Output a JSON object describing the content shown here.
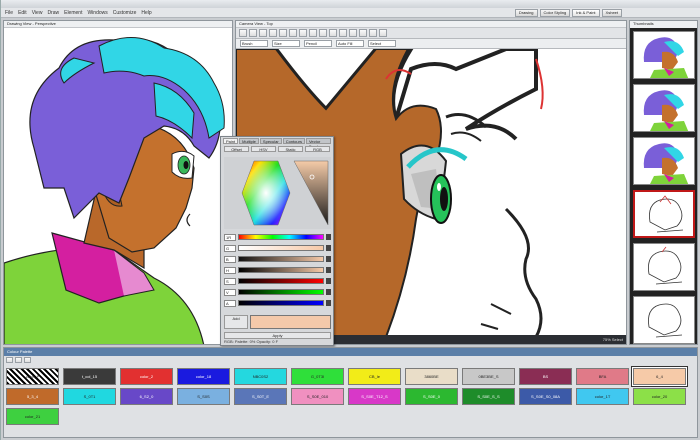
{
  "menu": {
    "items": [
      "File",
      "Edit",
      "View",
      "Draw",
      "Element",
      "Windows",
      "Customize",
      "Help"
    ]
  },
  "workspace_buttons": [
    "Drawing",
    "Color Styling",
    "Ink & Paint",
    "Xsheet"
  ],
  "left_panel": {
    "title": "Drawing View - Perspective"
  },
  "main_view": {
    "title": "Camera View - Top",
    "props": [
      "Brush",
      "Size",
      "Pencil",
      "Auto Fill",
      "Select"
    ],
    "status_right": "75% Select"
  },
  "thumbnails": {
    "title": "Thumbnails"
  },
  "color_picker": {
    "tabs": [
      "Paint",
      "Multiple",
      "Specular",
      "Contours",
      "Vector Brush"
    ],
    "modes": [
      "Offset",
      "HSV",
      "Static",
      "RGB"
    ],
    "sliders": [
      {
        "label": "1R",
        "value": "255"
      },
      {
        "label": "G",
        "value": "218"
      },
      {
        "label": "B",
        "value": "198"
      },
      {
        "label": "H",
        "value": "24"
      },
      {
        "label": "S",
        "value": "22"
      },
      {
        "label": "V",
        "value": "100"
      },
      {
        "label": "A",
        "value": "100"
      }
    ],
    "btn_add": "Add",
    "btn_apply": "Apply",
    "status": "RGB: Palette: 0% Opacity: 0 F"
  },
  "palette": {
    "title": "Colour Palette",
    "swatches": [
      {
        "name": "color_P",
        "color": "#f4f4f4",
        "row": 0,
        "col": 0,
        "text": "light",
        "pattern": true
      },
      {
        "name": "t_col_15",
        "color": "#3a3a3a",
        "row": 0,
        "col": 1,
        "text": "dark"
      },
      {
        "name": "color_2",
        "color": "#e23030",
        "row": 0,
        "col": 2,
        "text": "dark"
      },
      {
        "name": "color_18",
        "color": "#1a1adf",
        "row": 0,
        "col": 3,
        "text": "dark"
      },
      {
        "name": "NBC0S2",
        "color": "#24d8df",
        "row": 0,
        "col": 4,
        "text": "light"
      },
      {
        "name": "G_0T3I",
        "color": "#2fdf3a",
        "row": 0,
        "col": 5,
        "text": "light"
      },
      {
        "name": "CB_le",
        "color": "#f2ec18",
        "row": 0,
        "col": 6,
        "text": "light"
      },
      {
        "name": "3860BE",
        "color": "#e9ddc8",
        "row": 0,
        "col": 7,
        "text": "light"
      },
      {
        "name": "0BE3BE_S",
        "color": "#c8c8c8",
        "row": 0,
        "col": 8,
        "text": "light"
      },
      {
        "name": "BS",
        "color": "#8a2d54",
        "row": 0,
        "col": 9,
        "text": "dark"
      },
      {
        "name": "BFA",
        "color": "#e07a88",
        "row": 0,
        "col": 10,
        "text": "light"
      },
      {
        "name": "6_4",
        "color": "#f6caa8",
        "row": 0,
        "col": 11,
        "text": "light",
        "selected": true
      },
      {
        "name": "5_3_4",
        "color": "#c06a2a",
        "row": 1,
        "col": 0,
        "text": "dark"
      },
      {
        "name": "S_0T1",
        "color": "#20d8e0",
        "row": 1,
        "col": 1,
        "text": "light"
      },
      {
        "name": "6_S2_0",
        "color": "#6848c8",
        "row": 1,
        "col": 2,
        "text": "dark"
      },
      {
        "name": "S_S0S",
        "color": "#7ab0e0",
        "row": 1,
        "col": 3,
        "text": "light"
      },
      {
        "name": "S_S0T_E",
        "color": "#5a76b8",
        "row": 1,
        "col": 4,
        "text": "dark"
      },
      {
        "name": "S_S0E_010",
        "color": "#f090c0",
        "row": 1,
        "col": 5,
        "text": "light"
      },
      {
        "name": "S_S0E_T12_S",
        "color": "#d838c8",
        "row": 1,
        "col": 6,
        "text": "dark"
      },
      {
        "name": "S_S0E_0",
        "color": "#2cb830",
        "row": 1,
        "col": 7,
        "text": "dark"
      },
      {
        "name": "S_S0E_S_S",
        "color": "#1e8c2a",
        "row": 1,
        "col": 8,
        "text": "dark"
      },
      {
        "name": "S_S0E_S0_08A",
        "color": "#3c5aa8",
        "row": 1,
        "col": 9,
        "text": "dark"
      },
      {
        "name": "color_1T",
        "color": "#40c8f0",
        "row": 1,
        "col": 10,
        "text": "light"
      },
      {
        "name": "color_20",
        "color": "#8ce048",
        "row": 1,
        "col": 11,
        "text": "light"
      },
      {
        "name": "color_21",
        "color": "#3ed040",
        "row": 2,
        "col": 0,
        "text": "light"
      }
    ]
  }
}
